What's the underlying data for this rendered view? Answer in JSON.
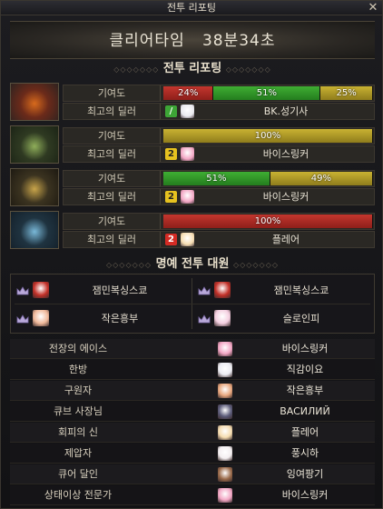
{
  "window": {
    "title": "전투 리포팅",
    "close_label": "✕"
  },
  "clear_time": {
    "label": "클리어타임",
    "value": "38분34초"
  },
  "battle_report": {
    "header": "전투 리포팅",
    "contribution_label": "기여도",
    "top_dealer_label": "최고의 딜러",
    "dungeons": [
      {
        "thumb_colors": [
          "#6b2a1a",
          "#d76a1c",
          "#2e2320"
        ],
        "segments": [
          {
            "color": "red",
            "percent": 24,
            "label": "24%"
          },
          {
            "color": "green",
            "percent": 51,
            "label": "51%"
          },
          {
            "color": "yellow",
            "percent": 25,
            "label": "25%"
          }
        ],
        "dealer": {
          "badge": "/",
          "badge_color": "green",
          "avatar_color": "#e9e9ee",
          "name": "BK.성기사"
        }
      },
      {
        "thumb_colors": [
          "#2f3a22",
          "#8fae5a",
          "#1c2416"
        ],
        "segments": [
          {
            "color": "yellow",
            "percent": 100,
            "label": "100%"
          }
        ],
        "dealer": {
          "badge": "2",
          "badge_color": "yellow",
          "avatar_color": "#f2a6c4",
          "name": "바이스링커"
        }
      },
      {
        "thumb_colors": [
          "#3b3320",
          "#c9a54a",
          "#1e1a12"
        ],
        "segments": [
          {
            "color": "green",
            "percent": 51,
            "label": "51%"
          },
          {
            "color": "yellow",
            "percent": 49,
            "label": "49%"
          }
        ],
        "dealer": {
          "badge": "2",
          "badge_color": "yellow",
          "avatar_color": "#f2a6c4",
          "name": "바이스링커"
        }
      },
      {
        "thumb_colors": [
          "#1f3340",
          "#79b8d8",
          "#14202a"
        ],
        "segments": [
          {
            "color": "red",
            "percent": 100,
            "label": "100%"
          }
        ],
        "dealer": {
          "badge": "2",
          "badge_color": "red",
          "avatar_color": "#f5dcb0",
          "name": "플레어"
        }
      }
    ]
  },
  "honor": {
    "header": "명예 전투 대원",
    "members": [
      {
        "icon_color": "#c23028",
        "name": "잼민복싱스쿄"
      },
      {
        "icon_color": "#c23028",
        "name": "잼민복싱스쿄"
      },
      {
        "icon_color": "#f0b89a",
        "name": "작은흥부"
      },
      {
        "icon_color": "#f4cfe0",
        "name": "슬로인피"
      }
    ]
  },
  "awards": [
    {
      "title": "전장의 에이스",
      "avatar_color": "#f2a6c4",
      "name": "바이스링커"
    },
    {
      "title": "한방",
      "avatar_color": "#ececf2",
      "name": "직감이요"
    },
    {
      "title": "구원자",
      "avatar_color": "#e8a77e",
      "name": "작은흥부"
    },
    {
      "title": "큐브 사장님",
      "avatar_color": "#5a5a78",
      "name": "BACИЛИЙ"
    },
    {
      "title": "회피의 신",
      "avatar_color": "#f5dcb0",
      "name": "플레어"
    },
    {
      "title": "제압자",
      "avatar_color": "#f3eef0",
      "name": "풍시하"
    },
    {
      "title": "큐어 달인",
      "avatar_color": "#9a6a4a",
      "name": "잉여팡기"
    },
    {
      "title": "상태이상 전문가",
      "avatar_color": "#f2a6c4",
      "name": "바이스링커"
    }
  ]
}
